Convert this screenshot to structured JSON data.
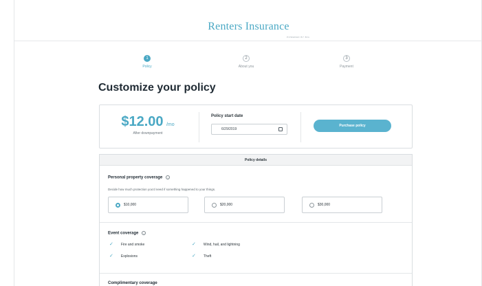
{
  "brand": {
    "title": "Renters Insurance",
    "subtitle": "POWERED BY BIG"
  },
  "steps": [
    {
      "num": "1",
      "label": "Policy"
    },
    {
      "num": "2",
      "label": "About you"
    },
    {
      "num": "3",
      "label": "Payment"
    }
  ],
  "page_title": "Customize your policy",
  "summary": {
    "price": "$12.00",
    "per": "/mo",
    "price_note": "After downpayment",
    "start_label": "Policy start date",
    "start_value": "6/29/2019",
    "purchase_label": "Purchase policy"
  },
  "details": {
    "header": "Policy details",
    "property": {
      "title": "Personal property coverage",
      "info": "i",
      "desc": "Decide how much protection you'd need if something happened to your things.",
      "options": [
        "$10,000",
        "$20,000",
        "$30,000"
      ],
      "selected": "$10,000"
    },
    "event": {
      "title": "Event coverage",
      "info": "i",
      "tick": "✓",
      "items": [
        "Fire and smoke",
        "Wind, hail, and lightning",
        "Explosions",
        "Theft"
      ]
    },
    "complimentary": {
      "title": "Complimentary coverage"
    }
  },
  "colors": {
    "accent": "#4aa8c4",
    "button": "#5ab3cf"
  }
}
